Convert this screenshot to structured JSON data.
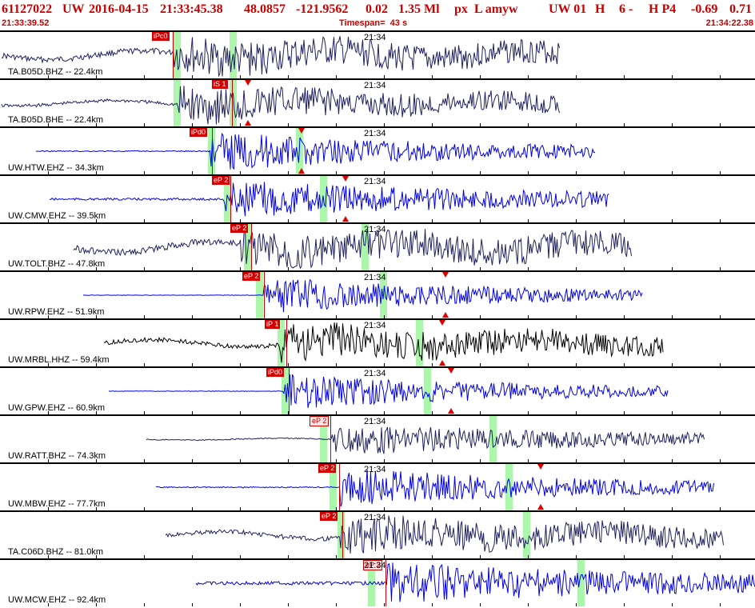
{
  "header": {
    "event_id": "61127022",
    "network": "UW",
    "date": "2016-04-15",
    "time": "21:33:45.38",
    "lat": "48.0857",
    "lon": "-121.9562",
    "depth": "0.02",
    "magnitude": "1.35 Ml",
    "flags": "px  L amyw",
    "network_code": "UW 01",
    "quality": "H",
    "count": "6 -",
    "h_param": "H P4",
    "val1": "-0.69",
    "val2": "0.71",
    "start_time": "21:33:39.52",
    "timespan": "Timespan=  43 s",
    "end_time": "21:34:22.38"
  },
  "time_marker": "21:34",
  "colors": {
    "header_text": "#c80000",
    "blue_trace": "#0000e6",
    "navy_trace": "#202060",
    "black_trace": "#000000",
    "pick": "#d40000",
    "green": "#9ef59e"
  },
  "panels": [
    {
      "label": "TA.B05D.BHZ -- 22.4km",
      "pick": "iPc0",
      "light": false
    },
    {
      "label": "TA.B05D.BHE -- 22.4km",
      "pick": "iS 1",
      "light": false
    },
    {
      "label": "UW.HTW.EHZ -- 34.3km",
      "pick": "iPd0",
      "light": false
    },
    {
      "label": "UW.CMW.EHZ -- 39.5km",
      "pick": "eP 2",
      "light": false
    },
    {
      "label": "UW.TOLT.BHZ -- 47.8km",
      "pick": "eP 2",
      "light": false
    },
    {
      "label": "UW.RPW.EHZ -- 51.9km",
      "pick": "eP 2",
      "light": false
    },
    {
      "label": "UW.MRBL.HHZ -- 59.4km",
      "pick": "iP 1",
      "light": false
    },
    {
      "label": "UW.GPW.EHZ -- 60.9km",
      "pick": "iPd0",
      "light": false
    },
    {
      "label": "UW.RATT.BHZ -- 74.3km",
      "pick": "eP 2",
      "light": true
    },
    {
      "label": "UW.MBW.EHZ -- 77.7km",
      "pick": "eP 2",
      "light": false
    },
    {
      "label": "TA.C06D.BHZ -- 81.0km",
      "pick": "eP 2",
      "light": false
    },
    {
      "label": "UW.MCW.EHZ -- 92.4km",
      "pick": "eP 2",
      "light": true
    }
  ]
}
